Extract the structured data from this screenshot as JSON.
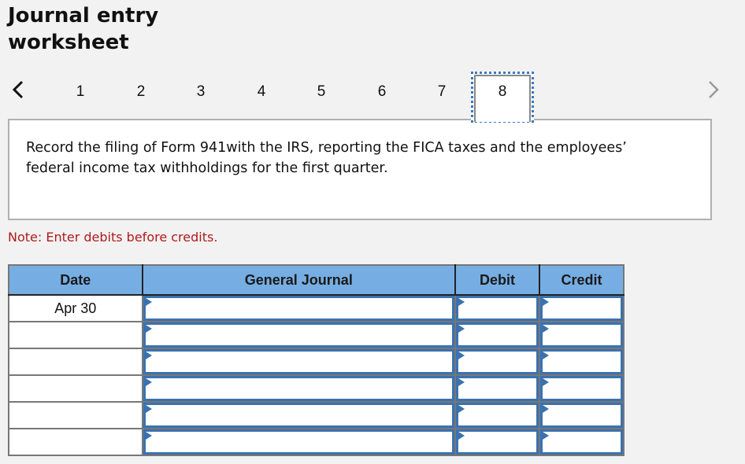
{
  "header": {
    "title": "Journal entry worksheet"
  },
  "pager": {
    "prev_icon": "chevron-left-icon",
    "next_icon": "chevron-right-icon",
    "pages": [
      "1",
      "2",
      "3",
      "4",
      "5",
      "6",
      "7",
      "8"
    ],
    "current_page": "8"
  },
  "question": {
    "text": "Record the filing of Form 941with the IRS, reporting the FICA taxes and the employees’ federal income tax withholdings for the first quarter."
  },
  "note": "Note: Enter debits before credits.",
  "journal": {
    "columns": {
      "date": "Date",
      "general_journal": "General Journal",
      "debit": "Debit",
      "credit": "Credit"
    },
    "rows": [
      {
        "date": "Apr 30",
        "account": "",
        "debit": "",
        "credit": ""
      },
      {
        "date": "",
        "account": "",
        "debit": "",
        "credit": ""
      },
      {
        "date": "",
        "account": "",
        "debit": "",
        "credit": ""
      },
      {
        "date": "",
        "account": "",
        "debit": "",
        "credit": ""
      },
      {
        "date": "",
        "account": "",
        "debit": "",
        "credit": ""
      },
      {
        "date": "",
        "account": "",
        "debit": "",
        "credit": ""
      }
    ]
  }
}
